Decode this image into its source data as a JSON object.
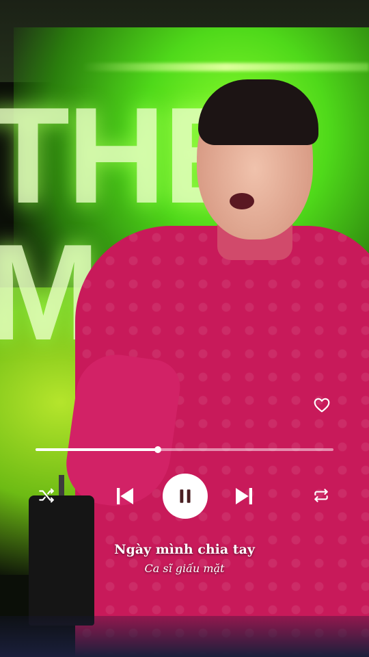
{
  "background": {
    "stage_sign_text": "THE M",
    "accent_color": "#4fd91a",
    "dress_color": "#c81a5a"
  },
  "player": {
    "like_icon": "heart-outline-icon",
    "progress_fraction": 0.41,
    "controls": {
      "shuffle_icon": "shuffle-icon",
      "previous_icon": "skip-previous-icon",
      "pause_icon": "pause-icon",
      "next_icon": "skip-next-icon",
      "repeat_icon": "repeat-icon"
    }
  },
  "track": {
    "title": "Ngày mình chia tay",
    "artist": "Ca sĩ giấu mặt"
  }
}
